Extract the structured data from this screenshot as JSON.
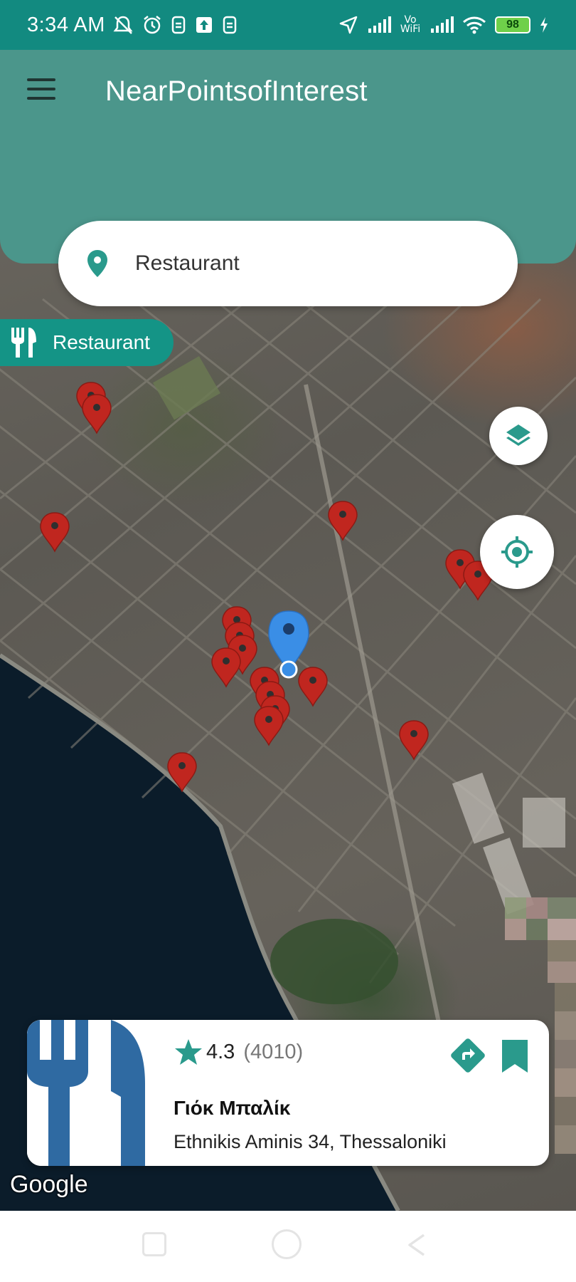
{
  "status_bar": {
    "time": "3:34 AM",
    "battery": "98",
    "vowifi": "Vo WiFi",
    "left_icons": [
      "mute-bell-icon",
      "alarm-icon",
      "sim-icon",
      "upload-icon",
      "sim-icon"
    ],
    "right_icons": [
      "location-arrow-icon",
      "signal-icon",
      "vowifi-icon",
      "signal-icon",
      "wifi-icon",
      "battery-icon",
      "charging-icon"
    ]
  },
  "app_bar": {
    "title": "NearPointsofInterest",
    "background": "#4b968b"
  },
  "search": {
    "value": "Restaurant",
    "icon": "location-pin-icon"
  },
  "category_chip": {
    "label": "Restaurant",
    "icon": "fork-knife-icon",
    "color": "#149486"
  },
  "map": {
    "type": "satellite",
    "buttons": [
      "layers-button",
      "my-location-button"
    ],
    "marker_color": "#c0261f",
    "user_marker_color": "#3a8ee6"
  },
  "place_card": {
    "rating": "4.3",
    "reviews": "(4010)",
    "name": "Γιόκ Μπαλίκ",
    "address": "Ethnikis Aminis 34, Thessaloniki",
    "accent": "#2a9a8c"
  },
  "attribution": "Google"
}
